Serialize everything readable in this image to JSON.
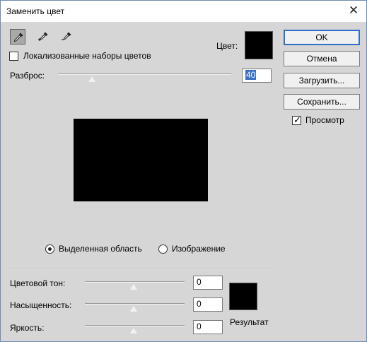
{
  "window": {
    "title": "Заменить цвет",
    "close_glyph": "✕"
  },
  "tools": [
    {
      "name": "eyedropper-tool",
      "icon": "eyedropper-icon",
      "active": true
    },
    {
      "name": "eyedropper-plus-tool",
      "icon": "eyedropper-plus-icon",
      "active": false
    },
    {
      "name": "eyedropper-minus-tool",
      "icon": "eyedropper-minus-icon",
      "active": false
    }
  ],
  "localized_colors": {
    "label": "Локализованные наборы цветов",
    "checked": false
  },
  "color": {
    "label": "Цвет:",
    "value": "#000000"
  },
  "fuzziness": {
    "label": "Разброс:",
    "value": "40"
  },
  "selection_mode": {
    "options": [
      {
        "label": "Выделенная область",
        "selected": true
      },
      {
        "label": "Изображение",
        "selected": false
      }
    ]
  },
  "hue": {
    "label": "Цветовой тон:",
    "value": "0"
  },
  "saturation": {
    "label": "Насыщенность:",
    "value": "0"
  },
  "lightness": {
    "label": "Яркость:",
    "value": "0"
  },
  "result": {
    "label": "Результат",
    "color": "#000000"
  },
  "buttons": {
    "ok": "OK",
    "cancel": "Отмена",
    "load": "Загрузить...",
    "save": "Сохранить..."
  },
  "preview_check": {
    "label": "Просмотр",
    "checked": true
  }
}
